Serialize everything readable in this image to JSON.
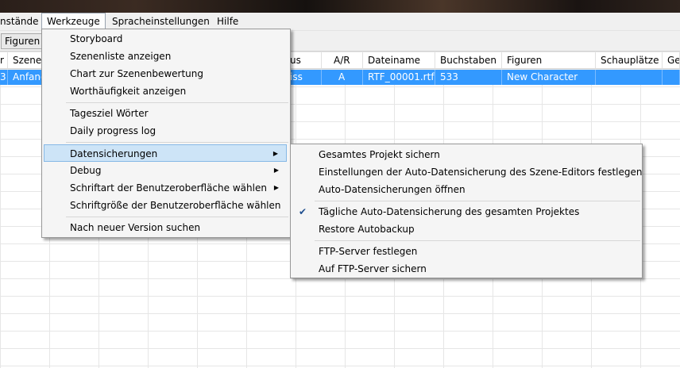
{
  "menubar": {
    "items": [
      "nstände",
      "Werkzeuge",
      "Spracheinstellungen",
      "Hilfe"
    ]
  },
  "toolbar": {
    "figuren": "Figuren"
  },
  "table": {
    "headers": [
      "r",
      "Szene",
      "us",
      "A/R",
      "Dateiname",
      "Buchstaben",
      "Figuren",
      "Schauplätze",
      "Ge"
    ],
    "row": [
      "3",
      "Anfang",
      "iss",
      "A",
      "RTF_00001.rtf",
      "533",
      "New Character",
      "",
      ""
    ]
  },
  "werkzeuge_menu": {
    "items": [
      "Storyboard",
      "Szenenliste anzeigen",
      "Chart zur Szenenbewertung",
      "Worthäufigkeit anzeigen",
      "Tagesziel Wörter",
      "Daily progress log",
      "Datensicherungen",
      "Debug",
      "Schriftart der Benutzeroberfläche wählen",
      "Schriftgröße der Benutzeroberfläche wählen",
      "Nach neuer Version suchen"
    ]
  },
  "datensicherungen_menu": {
    "items": [
      "Gesamtes Projekt sichern",
      "Einstellungen der Auto-Datensicherung des Szene-Editors festlegen",
      "Auto-Datensicherungen öffnen",
      "Tägliche Auto-Datensicherung des gesamten Projektes",
      "Restore Autobackup",
      "FTP-Server festlegen",
      "Auf FTP-Server sichern"
    ]
  },
  "icons": {
    "submenu": "chevron-right-icon",
    "check": "check-icon"
  },
  "colors": {
    "selection": "#3399ff",
    "menu_highlight": "#cde4f7"
  }
}
